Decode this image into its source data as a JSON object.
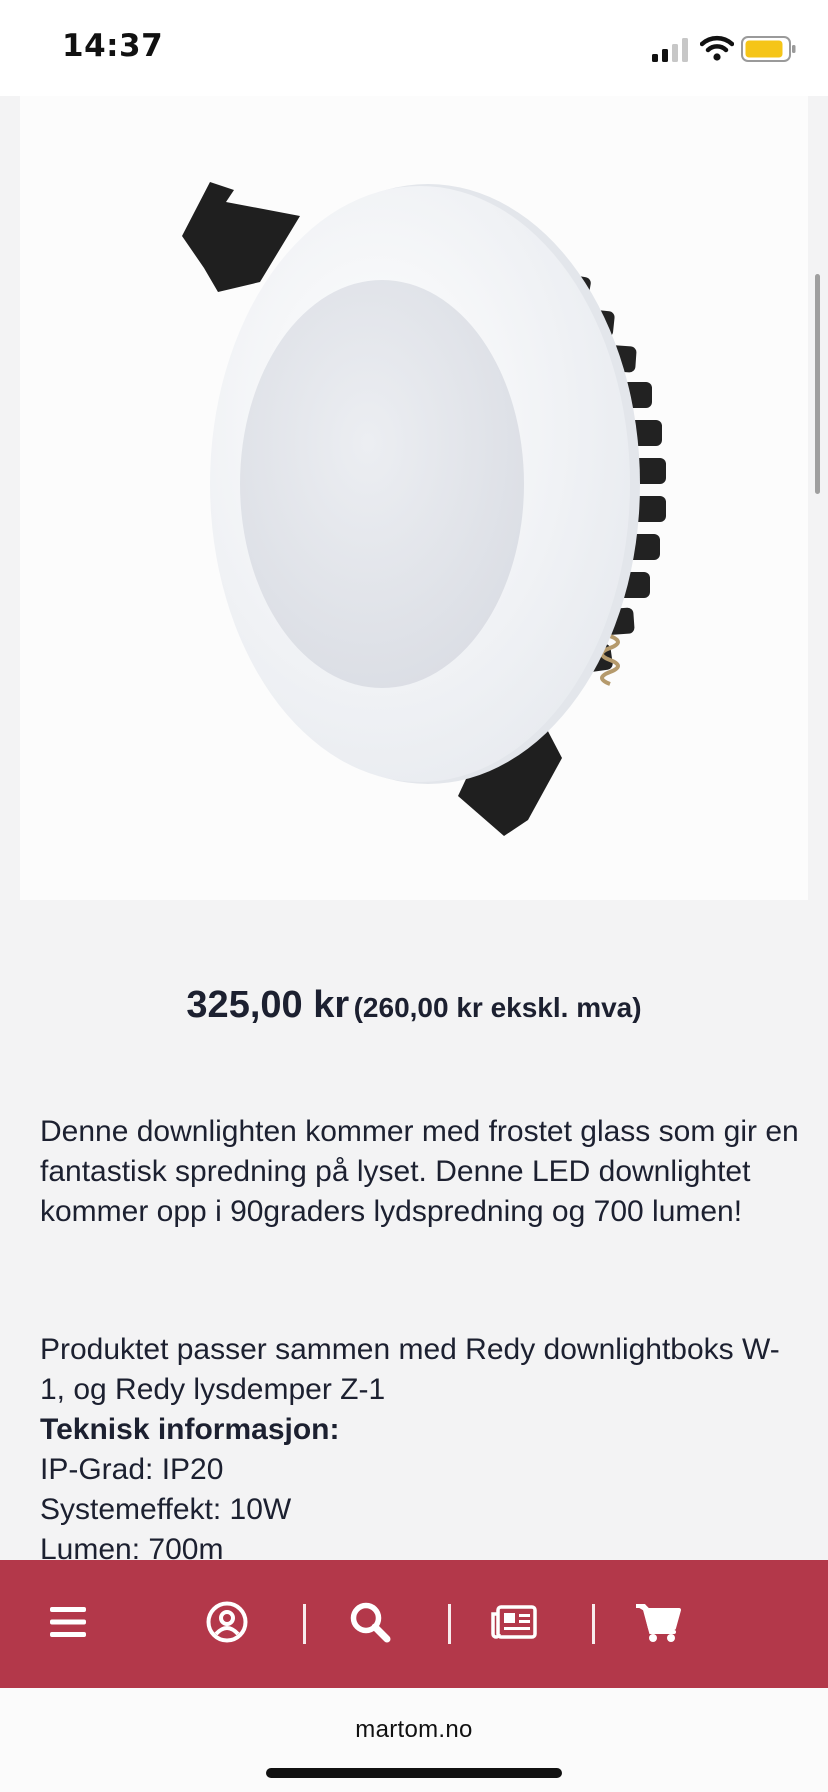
{
  "status_bar": {
    "time": "14:37",
    "icons": [
      "signal-icon",
      "wifi-icon",
      "battery-icon"
    ],
    "battery_color": "#f5c518"
  },
  "product": {
    "image_icon": "downlight-image",
    "price": "325,00 kr",
    "price_ex_vat": "(260,00 kr ekskl. mva)",
    "description": "Denne downlighten kommer med frostet glass som gir en fantastisk spredning på lyset. Denne LED downlightet kommer opp i 90graders lydspredning og 700 lumen!",
    "compatibility": "Produktet passer sammen med Redy downlightboks W-1, og Redy lysdemper Z-1",
    "specs_heading": "Teknisk informasjon:",
    "specs": [
      "IP-Grad: IP20",
      "Systemeffekt: 10W",
      "Lumen: 700m"
    ]
  },
  "bottom_nav": {
    "background": "#b3384a",
    "items": [
      {
        "icon": "menu-icon"
      },
      {
        "icon": "account-icon"
      },
      {
        "icon": "search-icon"
      },
      {
        "icon": "news-icon"
      },
      {
        "icon": "cart-icon"
      }
    ]
  },
  "browser": {
    "domain": "martom.no"
  }
}
